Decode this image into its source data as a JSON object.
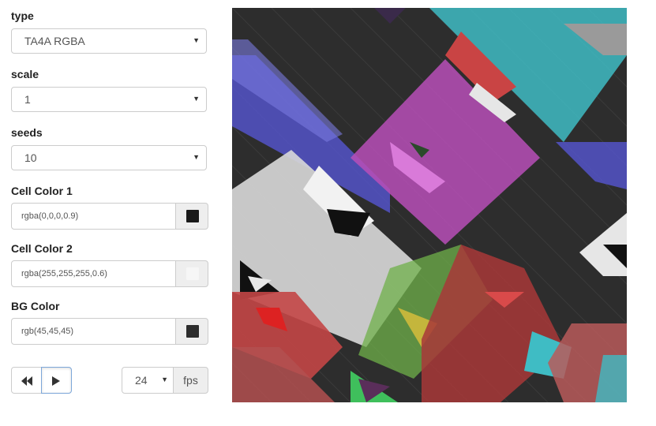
{
  "controls": {
    "type": {
      "label": "type",
      "value": "TA4A RGBA"
    },
    "scale": {
      "label": "scale",
      "value": "1"
    },
    "seeds": {
      "label": "seeds",
      "value": "10"
    },
    "cell_color_1": {
      "label": "Cell Color 1",
      "value": "rgba(0,0,0,0.9)",
      "swatch": "#1a1a1a"
    },
    "cell_color_2": {
      "label": "Cell Color 2",
      "value": "rgba(255,255,255,0.6)",
      "swatch": "#f6f6f6"
    },
    "bg_color": {
      "label": "BG Color",
      "value": "rgb(45,45,45)",
      "swatch": "#2d2d2d"
    }
  },
  "playback": {
    "rewind_icon": "fast-backward-icon",
    "play_icon": "play-icon",
    "fps_value": "24",
    "fps_unit": "fps"
  },
  "canvas": {
    "background": "#2d2d2d",
    "palette": [
      "#2d2d2d",
      "#5b5bd6",
      "#c45bc4",
      "#4cc9d0",
      "#c94a4a",
      "#e8e8e8",
      "#111111",
      "#7ac943",
      "#d2c13c",
      "#8f8f8f"
    ]
  }
}
